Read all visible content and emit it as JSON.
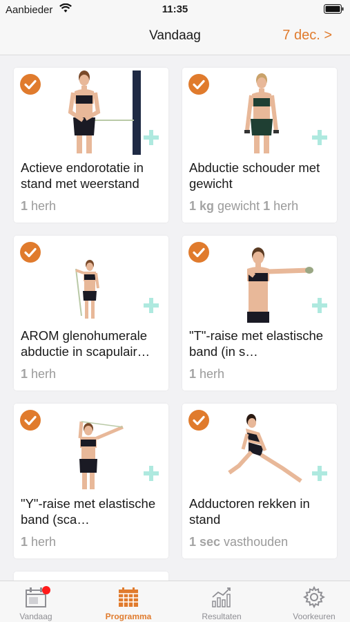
{
  "status": {
    "carrier": "Aanbieder",
    "time": "11:35"
  },
  "nav": {
    "title": "Vandaag",
    "date": "7 dec. >"
  },
  "colors": {
    "accent": "#e07b2d",
    "plus": "#aee9df",
    "inactive": "#8e8e93"
  },
  "cards": [
    {
      "title": "Actieve endorotatie in stand met weerstand",
      "meta_bold": "1",
      "meta_text": " herh",
      "meta_bold2": "",
      "meta_text2": "",
      "completed": true,
      "icon": "check-icon"
    },
    {
      "title": "Abductie schouder met gewicht",
      "meta_bold": "1 kg",
      "meta_text": " gewicht ",
      "meta_bold2": "1",
      "meta_text2": " herh",
      "completed": true,
      "icon": "check-icon"
    },
    {
      "title": "AROM glenohumerale abductie in scapulair…",
      "meta_bold": "1",
      "meta_text": " herh",
      "meta_bold2": "",
      "meta_text2": "",
      "completed": true,
      "icon": "check-icon"
    },
    {
      "title": "\"T\"-raise met elastische band (in s…",
      "meta_bold": "1",
      "meta_text": " herh",
      "meta_bold2": "",
      "meta_text2": "",
      "completed": true,
      "icon": "check-icon"
    },
    {
      "title": "\"Y\"-raise met elastische band (sca…",
      "meta_bold": "1",
      "meta_text": " herh",
      "meta_bold2": "",
      "meta_text2": "",
      "completed": true,
      "icon": "check-icon"
    },
    {
      "title": "Adductoren rekken in stand",
      "meta_bold": "1 sec",
      "meta_text": " vasthouden",
      "meta_bold2": "",
      "meta_text2": "",
      "completed": true,
      "icon": "check-icon"
    }
  ],
  "tabs": [
    {
      "label": "Vandaag",
      "icon": "calendar-icon",
      "active": false,
      "badge": true
    },
    {
      "label": "Programma",
      "icon": "schedule-grid-icon",
      "active": true,
      "badge": false
    },
    {
      "label": "Resultaten",
      "icon": "chart-icon",
      "active": false,
      "badge": false
    },
    {
      "label": "Voorkeuren",
      "icon": "gear-icon",
      "active": false,
      "badge": false
    }
  ]
}
